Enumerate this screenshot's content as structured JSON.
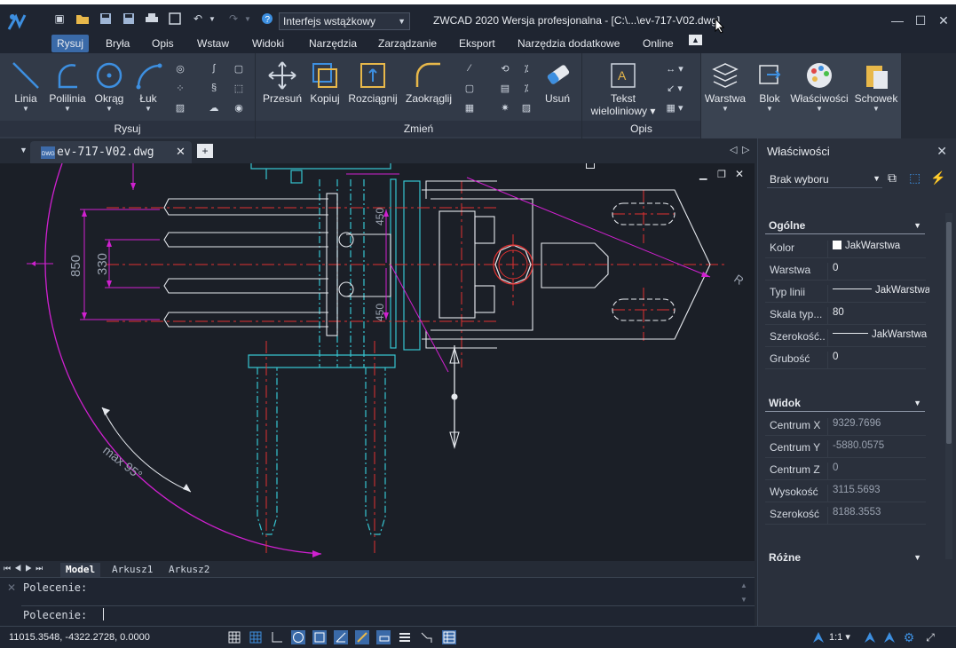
{
  "titlebar": {
    "workspace": "Interfejs wstążkowy",
    "app_title": "ZWCAD 2020 Wersja profesjonalna - [C:\\...\\ev-717-V02.dwg]"
  },
  "menu": [
    "Rysuj",
    "Bryła",
    "Opis",
    "Wstaw",
    "Widoki",
    "Narzędzia",
    "Zarządzanie",
    "Eksport",
    "Narzędzia dodatkowe",
    "Online"
  ],
  "ribbon": {
    "groups": {
      "rysuj": "Rysuj",
      "zmien": "Zmień",
      "opis": "Opis"
    },
    "draw_tools": [
      "Linia",
      "Polilinia",
      "Okrąg",
      "Łuk"
    ],
    "modify_tools": [
      "Przesuń",
      "Kopiuj",
      "Rozciągnij",
      "Zaokrąglij"
    ],
    "delete_tool": "Usuń",
    "text_tool_line1": "Tekst",
    "text_tool_line2": "wieloliniowy",
    "right_tools": [
      "Warstwa",
      "Blok",
      "Właściwości",
      "Schowek"
    ]
  },
  "document": {
    "tab": "ev-717-V02.dwg"
  },
  "drawing": {
    "dim_850": "850",
    "dim_330": "330",
    "dim_450a": "450",
    "dim_450b": "450",
    "angle_label": "max 95°",
    "radius_label": "R"
  },
  "sheets": [
    "Model",
    "Arkusz1",
    "Arkusz2"
  ],
  "command": {
    "history": "Polecenie:",
    "prompt": "Polecenie:"
  },
  "status": {
    "coords": "11015.3548, -4322.2728, 0.0000",
    "scale": "1:1"
  },
  "properties": {
    "title": "Właściwości",
    "selection": "Brak wyboru",
    "general": {
      "header": "Ogólne",
      "rows": [
        {
          "k": "Kolor",
          "v": "JakWarstwa"
        },
        {
          "k": "Warstwa",
          "v": "0"
        },
        {
          "k": "Typ linii",
          "v": "JakWarstwa"
        },
        {
          "k": "Skala typ...",
          "v": "80"
        },
        {
          "k": "Szerokość...",
          "v": "JakWarstwa"
        },
        {
          "k": "Grubość",
          "v": "0"
        }
      ]
    },
    "view": {
      "header": "Widok",
      "rows": [
        {
          "k": "Centrum X",
          "v": "9329.7696"
        },
        {
          "k": "Centrum Y",
          "v": "-5880.0575"
        },
        {
          "k": "Centrum Z",
          "v": "0"
        },
        {
          "k": "Wysokość",
          "v": "3115.5693"
        },
        {
          "k": "Szerokość",
          "v": "8188.3553"
        }
      ]
    },
    "misc": {
      "header": "Różne"
    }
  }
}
